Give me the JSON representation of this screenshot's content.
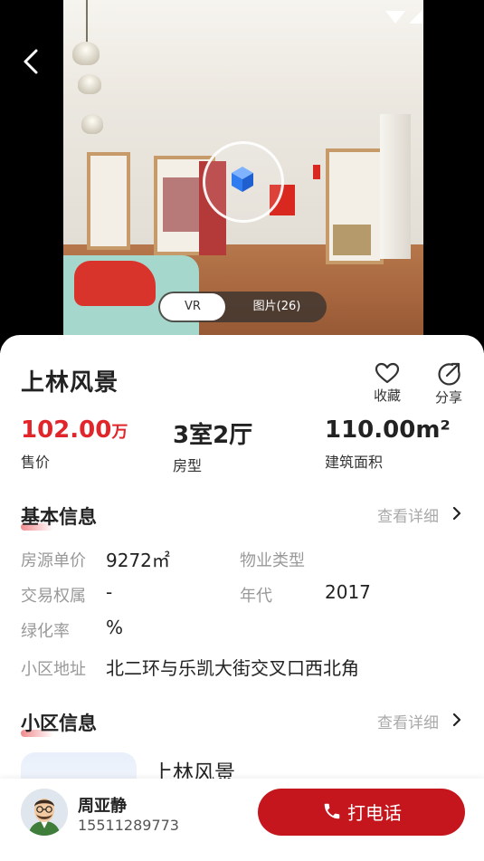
{
  "hero": {
    "tabs": [
      {
        "label": "VR",
        "active": true
      },
      {
        "label": "图片(26)",
        "active": false
      }
    ]
  },
  "listing": {
    "title": "上林风景",
    "actions": [
      {
        "label": "收藏",
        "icon": "heart-icon"
      },
      {
        "label": "分享",
        "icon": "share-icon"
      }
    ],
    "stats": [
      {
        "value": "102.00",
        "unit": "万",
        "label": "售价"
      },
      {
        "value": "3室2厅",
        "label": "房型"
      },
      {
        "value": "110.00m²",
        "label": "建筑面积"
      }
    ]
  },
  "basic_info": {
    "title": "基本信息",
    "more": "查看详细",
    "unit_price_label": "房源单价",
    "unit_price_value": "9272㎡",
    "property_type_label": "物业类型",
    "property_type_value": "",
    "ownership_label": "交易权属",
    "ownership_value": "-",
    "year_label": "年代",
    "year_value": "2017",
    "green_label": "绿化率",
    "green_value": "%",
    "address_label": "小区地址",
    "address_value": "北二环与乐凯大街交叉口西北角"
  },
  "community": {
    "title": "小区信息",
    "more": "查看详细",
    "name": "上林风景"
  },
  "agent": {
    "name": "周亚静",
    "phone": "15511289773",
    "call_label": "打电话"
  },
  "colors": {
    "price_red": "#e0262b",
    "call_button": "#c5161d",
    "section_accent": "#f08a8d"
  }
}
